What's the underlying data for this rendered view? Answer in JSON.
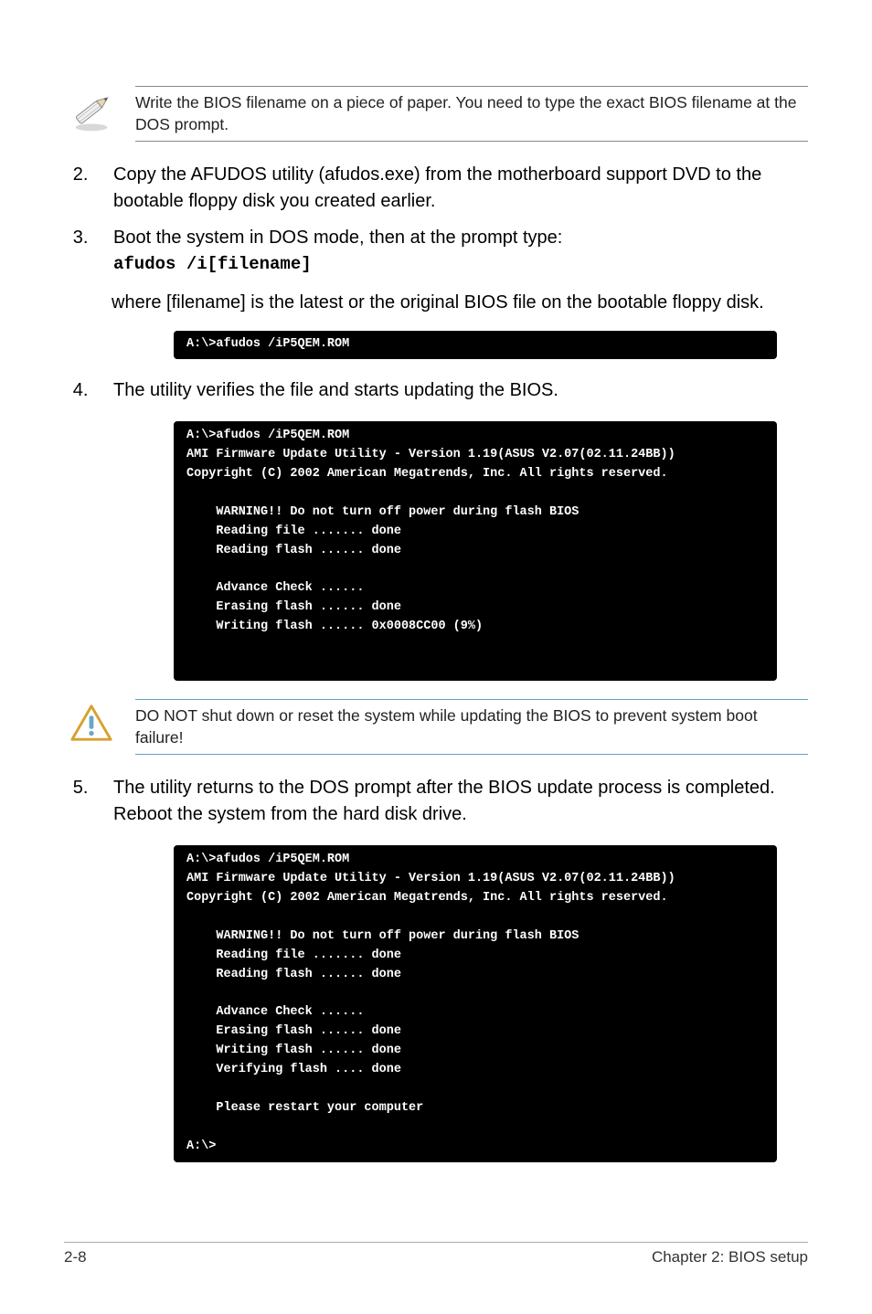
{
  "note_pencil": "Write the BIOS filename on a piece of paper. You need to type the exact BIOS filename at the DOS prompt.",
  "steps": {
    "s2": "Copy the AFUDOS utility (afudos.exe) from the motherboard support DVD to the bootable floppy disk you created earlier.",
    "s3a": "Boot the system in DOS mode, then at the prompt type:",
    "s3cmd": "afudos /i[filename]",
    "s3b": "where [filename] is the latest or the original BIOS file on the bootable floppy disk.",
    "s4": "The utility verifies the file and starts updating the BIOS.",
    "s5": "The utility returns to the DOS prompt after the BIOS update process is completed. Reboot the system from the hard disk drive."
  },
  "terminals": {
    "t1": "A:\\>afudos /iP5QEM.ROM",
    "t2": "A:\\>afudos /iP5QEM.ROM\nAMI Firmware Update Utility - Version 1.19(ASUS V2.07(02.11.24BB))\nCopyright (C) 2002 American Megatrends, Inc. All rights reserved.\n\n    WARNING!! Do not turn off power during flash BIOS\n    Reading file ....... done\n    Reading flash ...... done\n\n    Advance Check ......\n    Erasing flash ...... done\n    Writing flash ...... 0x0008CC00 (9%)\n\n\n",
    "t3": "A:\\>afudos /iP5QEM.ROM\nAMI Firmware Update Utility - Version 1.19(ASUS V2.07(02.11.24BB))\nCopyright (C) 2002 American Megatrends, Inc. All rights reserved.\n\n    WARNING!! Do not turn off power during flash BIOS\n    Reading file ....... done\n    Reading flash ...... done\n\n    Advance Check ......\n    Erasing flash ...... done\n    Writing flash ...... done\n    Verifying flash .... done\n\n    Please restart your computer\n\nA:\\>"
  },
  "warning_note": "DO NOT shut down or reset the system while updating the BIOS to prevent system boot failure!",
  "footer_left": "2-8",
  "footer_right": "Chapter 2: BIOS setup"
}
